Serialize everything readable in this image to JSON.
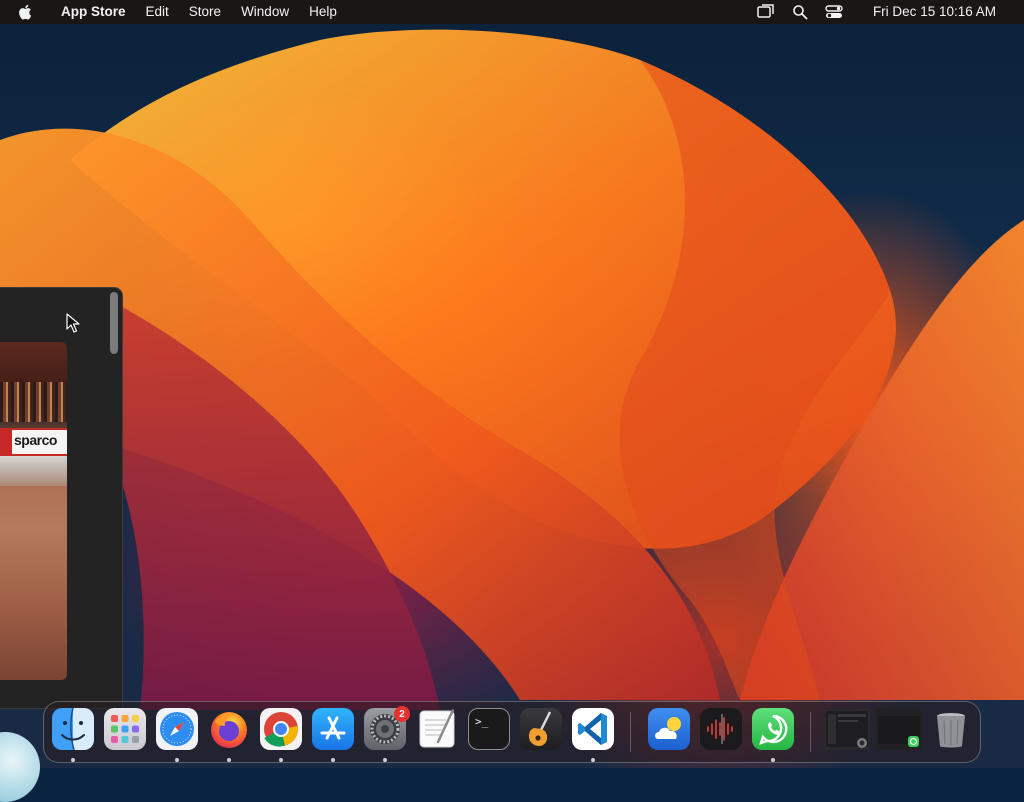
{
  "menubar": {
    "app_name": "App Store",
    "menus": [
      "Edit",
      "Store",
      "Window",
      "Help"
    ],
    "clock": "Fri Dec 15  10:16 AM",
    "status_icons": [
      "screen-mirroring-icon",
      "spotlight-search-icon",
      "control-center-icon"
    ]
  },
  "thumbnail": {
    "banner_text": "sparco"
  },
  "dock": {
    "apps": [
      {
        "name": "Finder",
        "icon": "finder-icon",
        "running": true
      },
      {
        "name": "Launchpad",
        "icon": "launchpad-icon",
        "running": false
      },
      {
        "name": "Safari",
        "icon": "safari-icon",
        "running": true
      },
      {
        "name": "Firefox",
        "icon": "firefox-icon",
        "running": true
      },
      {
        "name": "Google Chrome",
        "icon": "chrome-icon",
        "running": true
      },
      {
        "name": "App Store",
        "icon": "app-store-icon",
        "running": true
      },
      {
        "name": "System Settings",
        "icon": "system-settings-icon",
        "running": true,
        "badge": "2"
      },
      {
        "name": "TextEdit",
        "icon": "textedit-icon",
        "running": false
      },
      {
        "name": "Terminal",
        "icon": "terminal-icon",
        "running": false
      },
      {
        "name": "GarageBand",
        "icon": "garageband-icon",
        "running": false
      },
      {
        "name": "Visual Studio Code",
        "icon": "vscode-icon",
        "running": true
      },
      {
        "name": "Weather",
        "icon": "weather-icon",
        "running": false
      },
      {
        "name": "Voice Memos",
        "icon": "voice-memos-icon",
        "running": false
      },
      {
        "name": "WhatsApp",
        "icon": "whatsapp-icon",
        "running": true
      },
      {
        "name": "Minimized App Store Window",
        "icon": "minimized-window-icon",
        "running": false
      },
      {
        "name": "Minimized WhatsApp Window",
        "icon": "minimized-window-icon",
        "running": false
      },
      {
        "name": "Trash",
        "icon": "trash-icon",
        "running": false
      }
    ],
    "terminal_prompt": ">_"
  },
  "colors": {
    "menubar_bg": "#1c1614",
    "badge_red": "#e5322f",
    "wallpaper_orange": "#ff6e14"
  }
}
